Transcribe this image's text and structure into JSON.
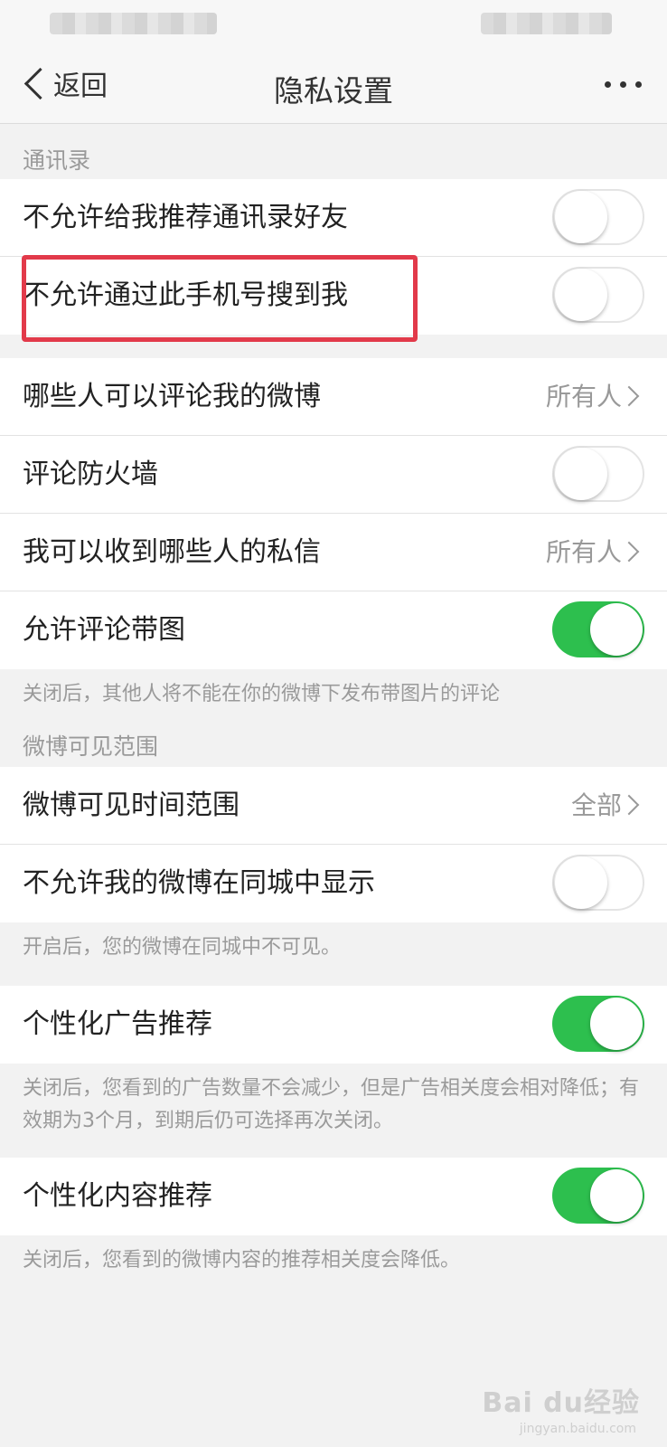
{
  "nav": {
    "back_label": "返回",
    "title": "隐私设置"
  },
  "sections": {
    "contacts": "通讯录",
    "visibility": "微博可见范围"
  },
  "rows": [
    {
      "label": "不允许给我推荐通讯录好友",
      "toggle": false
    },
    {
      "label": "不允许通过此手机号搜到我",
      "toggle": false
    },
    {
      "label": "哪些人可以评论我的微博",
      "value": "所有人"
    },
    {
      "label": "评论防火墙",
      "toggle": false
    },
    {
      "label": "我可以收到哪些人的私信",
      "value": "所有人"
    },
    {
      "label": "允许评论带图",
      "toggle": true
    },
    {
      "label": "微博可见时间范围",
      "value": "全部"
    },
    {
      "label": "不允许我的微博在同城中显示",
      "toggle": false
    },
    {
      "label": "个性化广告推荐",
      "toggle": true
    },
    {
      "label": "个性化内容推荐",
      "toggle": true
    }
  ],
  "notes": {
    "comment_image": "关闭后，其他人将不能在你的微博下发布带图片的评论",
    "local_city": "开启后，您的微博在同城中不可见。",
    "ads": "关闭后，您看到的广告数量不会减少，但是广告相关度会相对降低；有效期为3个月，到期后仍可选择再次关闭。",
    "content": "关闭后，您看到的微博内容的推荐相关度会降低。"
  },
  "colors": {
    "toggle_on": "#2dbf4e",
    "highlight": "#e23a4a"
  },
  "watermark": {
    "brand": "Bai du经验",
    "url": "jingyan.baidu.com"
  }
}
